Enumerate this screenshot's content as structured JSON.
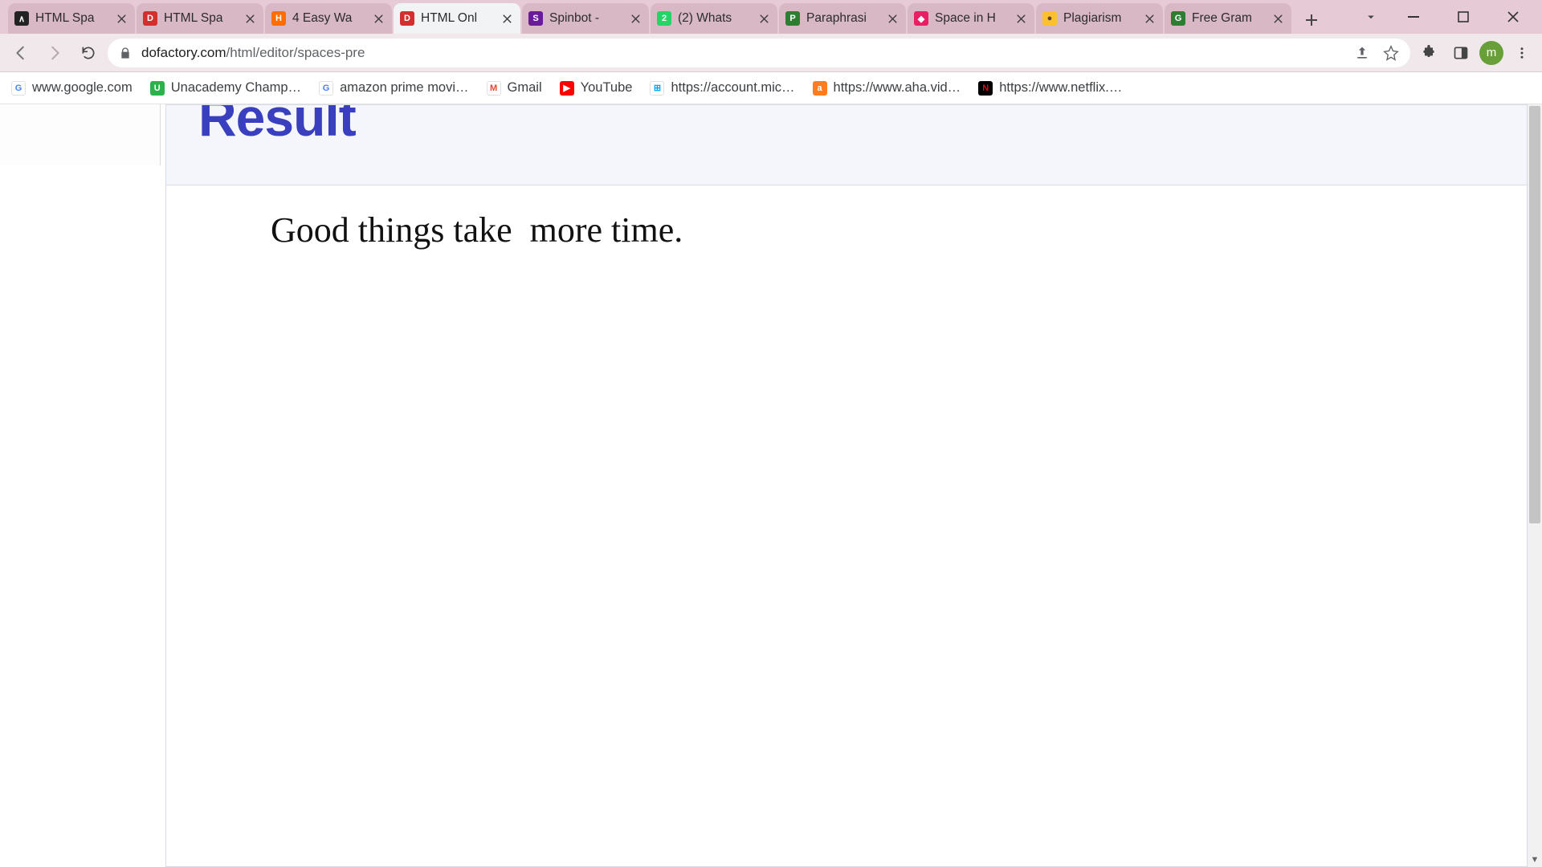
{
  "window": {
    "avatar_letter": "m"
  },
  "tabs": [
    {
      "label": "HTML Spa",
      "favbg": "#222222",
      "favfg": "#ffffff",
      "favtxt": "∧",
      "active": false
    },
    {
      "label": "HTML Spa",
      "favbg": "#d32f2f",
      "favfg": "#ffffff",
      "favtxt": "D",
      "active": false
    },
    {
      "label": "4 Easy Wa",
      "favbg": "#ff6d00",
      "favfg": "#ffffff",
      "favtxt": "H",
      "active": false
    },
    {
      "label": "HTML Onl",
      "favbg": "#d32f2f",
      "favfg": "#ffffff",
      "favtxt": "D",
      "active": true
    },
    {
      "label": "Spinbot -",
      "favbg": "#6a1b9a",
      "favfg": "#ffffff",
      "favtxt": "S",
      "active": false
    },
    {
      "label": "(2) Whats",
      "favbg": "#25d366",
      "favfg": "#ffffff",
      "favtxt": "2",
      "active": false
    },
    {
      "label": "Paraphrasi",
      "favbg": "#2e7d32",
      "favfg": "#ffffff",
      "favtxt": "P",
      "active": false
    },
    {
      "label": "Space in H",
      "favbg": "#e91e63",
      "favfg": "#ffffff",
      "favtxt": "◆",
      "active": false
    },
    {
      "label": "Plagiarism",
      "favbg": "#fbc02d",
      "favfg": "#5d4037",
      "favtxt": "●",
      "active": false
    },
    {
      "label": "Free Gram",
      "favbg": "#2e7d32",
      "favfg": "#ffffff",
      "favtxt": "G",
      "active": false
    }
  ],
  "address": {
    "host": "dofactory.com",
    "path": "/html/editor/spaces-pre"
  },
  "bookmarks": [
    {
      "label": "www.google.com",
      "iconbg": "#ffffff",
      "iconborder": "#e0e0e0",
      "icontxt": "G",
      "iconfg": "#4285f4"
    },
    {
      "label": "Unacademy Champ…",
      "iconbg": "#2bb24c",
      "icontxt": "U",
      "iconfg": "#ffffff"
    },
    {
      "label": "amazon prime movi…",
      "iconbg": "#ffffff",
      "iconborder": "#e0e0e0",
      "icontxt": "G",
      "iconfg": "#4285f4"
    },
    {
      "label": "Gmail",
      "iconbg": "#ffffff",
      "iconborder": "#e0e0e0",
      "icontxt": "M",
      "iconfg": "#ea4335"
    },
    {
      "label": "YouTube",
      "iconbg": "#ff0000",
      "icontxt": "▶",
      "iconfg": "#ffffff"
    },
    {
      "label": "https://account.mic…",
      "iconbg": "#ffffff",
      "iconborder": "#e0e0e0",
      "icontxt": "⊞",
      "iconfg": "#00a4ef"
    },
    {
      "label": "https://www.aha.vid…",
      "iconbg": "#ff7c1f",
      "icontxt": "a",
      "iconfg": "#ffffff"
    },
    {
      "label": "https://www.netflix.…",
      "iconbg": "#000000",
      "icontxt": "N",
      "iconfg": "#e50914"
    }
  ],
  "page": {
    "heading": "Result",
    "body_text": "Good things take  more time."
  }
}
